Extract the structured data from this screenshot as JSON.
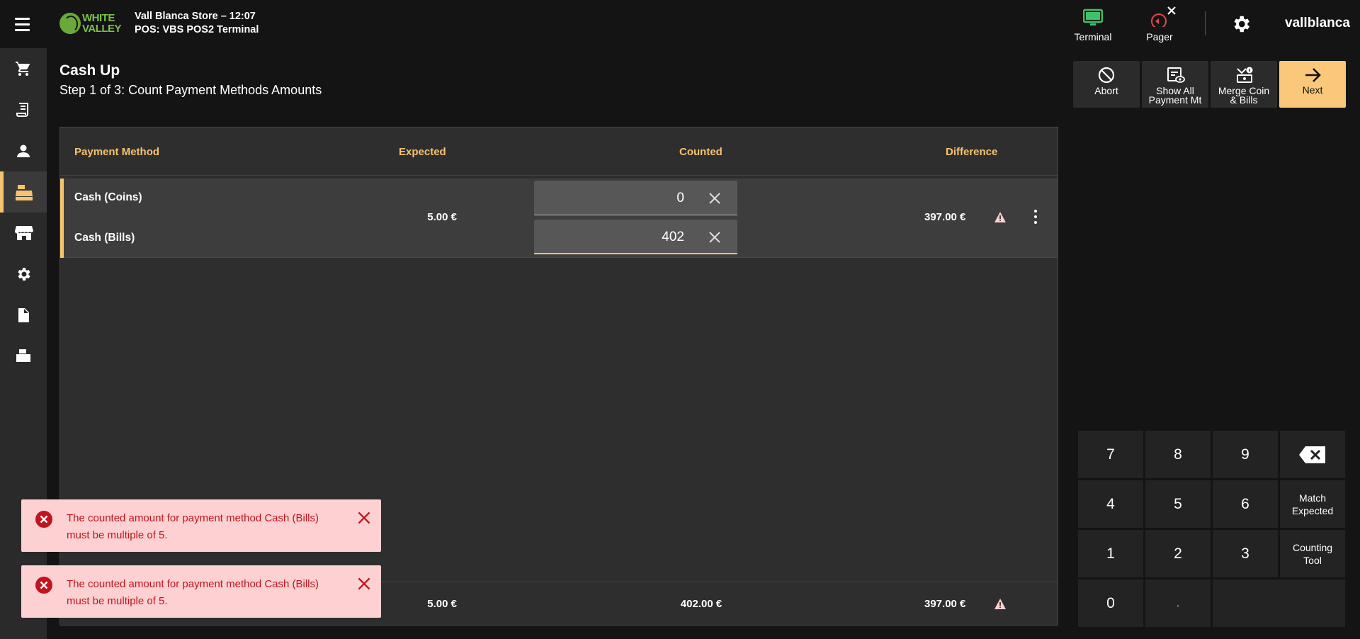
{
  "header": {
    "logo_text": [
      "WHITE",
      "VALLEY"
    ],
    "store_line": "Vall Blanca Store – 12:07",
    "pos_line": "POS: VBS POS2 Terminal",
    "terminal_label": "Terminal",
    "pager_label": "Pager",
    "username": "vallblanca",
    "colors": {
      "terminal_icon": "#3ec26a",
      "pager_icon": "#e0474f"
    }
  },
  "sidebar": {
    "items": [
      {
        "icon": "cart-icon"
      },
      {
        "icon": "receipt-icon"
      },
      {
        "icon": "person-icon"
      },
      {
        "icon": "cash-register-icon",
        "active": true
      },
      {
        "icon": "store-icon"
      },
      {
        "icon": "gear-icon"
      },
      {
        "icon": "document-icon"
      },
      {
        "icon": "printer-icon"
      }
    ]
  },
  "page": {
    "title": "Cash Up",
    "subtitle": "Step 1 of 3: Count Payment Methods Amounts"
  },
  "actions": {
    "abort": "Abort",
    "show_all": [
      "Show All",
      "Payment Mt"
    ],
    "merge": [
      "Merge Coin",
      "& Bills"
    ],
    "next": "Next"
  },
  "table": {
    "headers": {
      "payment_method": "Payment Method",
      "expected": "Expected",
      "counted": "Counted",
      "difference": "Difference"
    },
    "row": {
      "methods": [
        "Cash (Coins)",
        "Cash (Bills)"
      ],
      "expected": "5.00 €",
      "counted_values": [
        "0",
        "402"
      ],
      "difference": "397.00 €"
    },
    "totals": {
      "expected": "5.00 €",
      "counted": "402.00 €",
      "difference": "397.00 €"
    }
  },
  "keypad": {
    "digits": [
      "7",
      "8",
      "9",
      "4",
      "5",
      "6",
      "1",
      "2",
      "3",
      "0",
      "."
    ],
    "match_expected": [
      "Match",
      "Expected"
    ],
    "counting_tool": [
      "Counting",
      "Tool"
    ]
  },
  "toasts": [
    {
      "message": "The counted amount for payment method Cash (Bills) must be multiple of 5."
    },
    {
      "message": "The counted amount for payment method Cash (Bills) must be multiple of 5."
    }
  ],
  "colors": {
    "accent": "#f7c36f",
    "error_bg": "#fdd0d2",
    "error_text": "#c0151e"
  }
}
